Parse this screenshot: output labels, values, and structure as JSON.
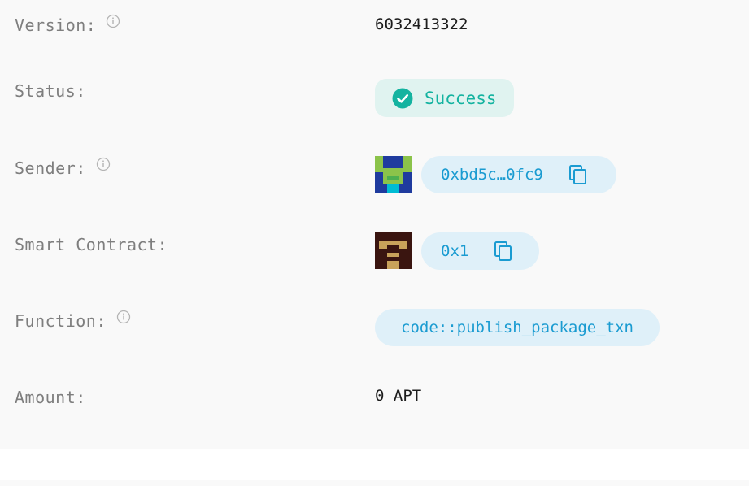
{
  "rows": {
    "version": {
      "label": "Version:",
      "value": "6032413322"
    },
    "status": {
      "label": "Status:",
      "value": "Success"
    },
    "sender": {
      "label": "Sender:",
      "address": "0xbd5c…0fc9"
    },
    "contract": {
      "label": "Smart Contract:",
      "address": "0x1"
    },
    "function": {
      "label": "Function:",
      "value": "code::publish_package_txn"
    },
    "amount": {
      "label": "Amount:",
      "value": "0 APT"
    }
  },
  "colors": {
    "label": "#7e7e7e",
    "value": "#1d1d1d",
    "success_bg": "#e0f3f0",
    "success_fg": "#14b3a0",
    "address_bg": "#dff0f9",
    "address_fg": "#1a9bd1"
  },
  "icons": [
    "info-icon",
    "check-circle-icon",
    "copy-icon",
    "sender-avatar",
    "contract-avatar"
  ]
}
